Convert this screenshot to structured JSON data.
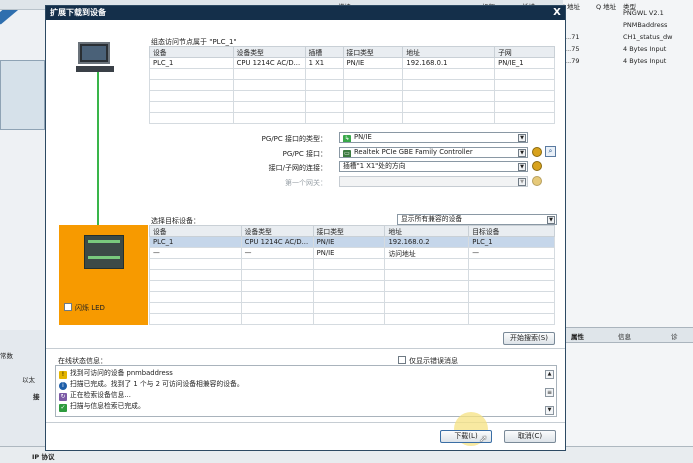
{
  "background": {
    "top_headers": [
      "模块",
      "机架",
      "插槽",
      "I 地址",
      "Q 地址",
      "类型"
    ],
    "type_column": [
      "PNGWL V2.1",
      "PNMBaddress",
      "CH1_status_dw",
      "4 Bytes Input",
      "4 Bytes Input"
    ],
    "address_column": [
      "...71",
      "...75",
      "...79"
    ],
    "right_tabs": [
      "属性",
      "信息",
      "诊"
    ],
    "left_labels": [
      "常数",
      "以太",
      "接"
    ],
    "bottom_label": "IP 协议"
  },
  "dialog": {
    "title": "扩展下载到设备",
    "close": "X",
    "config_section": {
      "label": "组态访问节点属于 \"PLC_1\"",
      "headers": [
        "设备",
        "设备类型",
        "插槽",
        "接口类型",
        "地址",
        "子网"
      ],
      "rows": [
        [
          "PLC_1",
          "CPU 1214C AC/D...",
          "1 X1",
          "PN/IE",
          "192.168.0.1",
          "PN/IE_1"
        ]
      ]
    },
    "interface": {
      "type_label": "PG/PC 接口的类型：",
      "type_value": "PN/IE",
      "iface_label": "PG/PC 接口：",
      "iface_value": "Realtek PCIe GBE Family Controller",
      "conn_label": "接口/子网的连接：",
      "conn_value": "插槽\"1 X1\"处的方向",
      "gateway_label": "第一个网关："
    },
    "target_section": {
      "label": "选择目标设备：",
      "filter_value": "显示所有兼容的设备",
      "headers": [
        "设备",
        "设备类型",
        "接口类型",
        "地址",
        "目标设备"
      ],
      "rows": [
        [
          "PLC_1",
          "CPU 1214C AC/D...",
          "PN/IE",
          "192.168.0.2",
          "PLC_1"
        ],
        [
          "—",
          "—",
          "PN/IE",
          "访问地址",
          "—"
        ]
      ]
    },
    "flash_led_label": "闪烁 LED",
    "start_search": "开始搜索(S)",
    "status": {
      "label": "在线状态信息：",
      "only_errors": "仅显示错误消息",
      "messages": [
        "找到可访问的设备 pnmbaddress",
        "扫描已完成。找到了 1 个与 2 可访问设备相兼容的设备。",
        "正在检索设备信息...",
        "扫描与信息检索已完成。"
      ]
    },
    "load_button": "下载(L)",
    "cancel_button": "取消(C)"
  }
}
